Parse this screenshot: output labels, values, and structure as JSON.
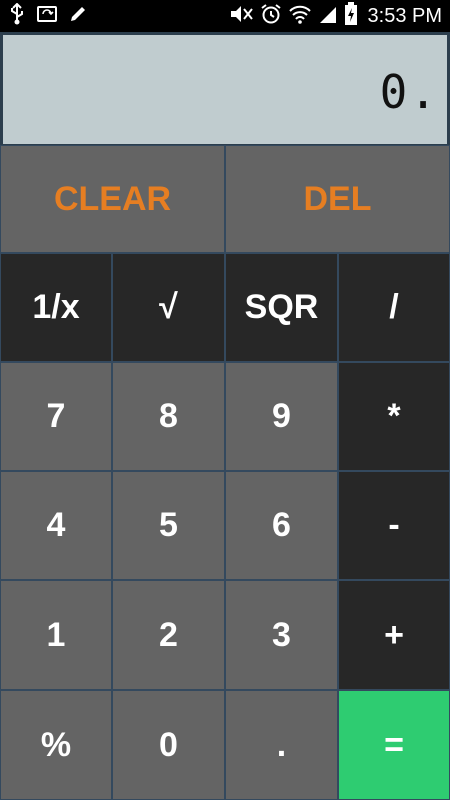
{
  "status_bar": {
    "time": "3:53 PM",
    "left_icons": [
      "usb-icon",
      "screen-capture-icon",
      "pencil-icon"
    ],
    "right_icons": [
      "mute-icon",
      "alarm-icon",
      "wifi-icon",
      "signal-icon",
      "battery-charging-icon"
    ]
  },
  "display": {
    "value": "0."
  },
  "buttons": {
    "clear": "CLEAR",
    "del": "DEL",
    "reciprocal": "1/x",
    "sqrt": "√",
    "sqr": "SQR",
    "divide": "/",
    "seven": "7",
    "eight": "8",
    "nine": "9",
    "multiply": "*",
    "four": "4",
    "five": "5",
    "six": "6",
    "subtract": "-",
    "one": "1",
    "two": "2",
    "three": "3",
    "add": "+",
    "percent": "%",
    "zero": "0",
    "decimal": ".",
    "equals": "="
  },
  "colors": {
    "accent_orange": "#e67e22",
    "equals_green": "#2ecc71",
    "display_bg": "#c0cccf",
    "operator_bg": "#272727",
    "number_bg": "#646464"
  }
}
